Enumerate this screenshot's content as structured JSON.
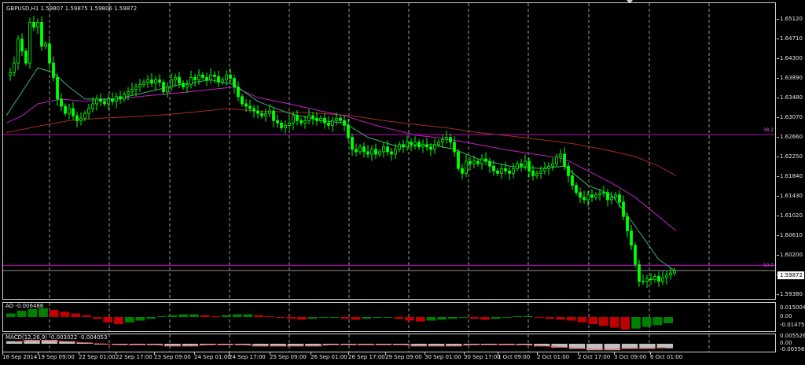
{
  "window": {
    "title": "GBPUSD,H1",
    "quote": "1.59807 1.59875 1.59806 1.59872"
  },
  "colors": {
    "background": "#000000",
    "candles": "#00ff00",
    "grid": "#c0c0c0",
    "ma_fast": "#3cb371",
    "ma_mid": "#c020c0",
    "ma_slow": "#a03020",
    "fib_line": "#c000c0",
    "ao_up": "#008000",
    "ao_down": "#c00000",
    "macd_hist": "#c0c0c0",
    "macd_signal": "#ff2020"
  },
  "price_scale": {
    "labels": [
      "1.65120",
      "1.64710",
      "1.64300",
      "1.63890",
      "1.63480",
      "1.63070",
      "1.62660",
      "1.62250",
      "1.61840",
      "1.61430",
      "1.61020",
      "1.60610",
      "1.60200",
      "1.59790",
      "1.59380"
    ],
    "current_price": "1.59872"
  },
  "fib_levels": [
    {
      "label": "38.2",
      "price": 1.6271
    },
    {
      "label": "50.0",
      "price": 1.5998
    }
  ],
  "ao": {
    "title": "AO -0.006486",
    "scale": [
      "0.015004",
      "0.00",
      "-0.014757"
    ]
  },
  "macd": {
    "title": "MACD(12,26,9) -0.003022 -0.004053",
    "scale": [
      "0.005526",
      "0.00",
      "-0.005566"
    ]
  },
  "time_axis": [
    "18 Sep 2014",
    "19 Sep 09:00",
    "22 Sep 01:00",
    "22 Sep 17:00",
    "23 Sep 09:00",
    "24 Sep 01:00",
    "24 Sep 17:00",
    "25 Sep 09:00",
    "26 Sep 01:00",
    "26 Sep 17:00",
    "29 Sep 09:00",
    "30 Sep 01:00",
    "30 Sep 17:00",
    "1 Oct 09:00",
    "2 Oct 01:00",
    "2 Oct 17:00",
    "3 Oct 09:00",
    "6 Oct 01:00"
  ],
  "chart_data": {
    "type": "line",
    "title": "GBPUSD,H1",
    "ylim": [
      1.5928,
      1.6545
    ],
    "close_path": [
      [
        0,
        1.6395
      ],
      [
        5,
        1.64
      ],
      [
        10,
        1.642
      ],
      [
        15,
        1.647
      ],
      [
        20,
        1.6445
      ],
      [
        25,
        1.642
      ],
      [
        30,
        1.6505
      ],
      [
        35,
        1.6495
      ],
      [
        40,
        1.6505
      ],
      [
        45,
        1.6455
      ],
      [
        50,
        1.646
      ],
      [
        55,
        1.642
      ],
      [
        60,
        1.639
      ],
      [
        65,
        1.6345
      ],
      [
        70,
        1.633
      ],
      [
        75,
        1.6315
      ],
      [
        80,
        1.6325
      ],
      [
        85,
        1.631
      ],
      [
        90,
        1.63
      ],
      [
        95,
        1.6305
      ],
      [
        100,
        1.6315
      ],
      [
        105,
        1.6325
      ],
      [
        110,
        1.6335
      ],
      [
        115,
        1.6345
      ],
      [
        120,
        1.634
      ],
      [
        125,
        1.6335
      ],
      [
        130,
        1.6345
      ],
      [
        135,
        1.634
      ],
      [
        140,
        1.635
      ],
      [
        145,
        1.6345
      ],
      [
        150,
        1.6355
      ],
      [
        155,
        1.636
      ],
      [
        160,
        1.6365
      ],
      [
        165,
        1.637
      ],
      [
        170,
        1.6375
      ],
      [
        175,
        1.638
      ],
      [
        180,
        1.6385
      ],
      [
        185,
        1.6378
      ],
      [
        190,
        1.6385
      ],
      [
        195,
        1.638
      ],
      [
        200,
        1.636
      ],
      [
        205,
        1.637
      ],
      [
        210,
        1.6385
      ],
      [
        215,
        1.639
      ],
      [
        220,
        1.6378
      ],
      [
        225,
        1.637
      ],
      [
        230,
        1.6375
      ],
      [
        235,
        1.639
      ],
      [
        240,
        1.6385
      ],
      [
        245,
        1.6395
      ],
      [
        250,
        1.639
      ],
      [
        255,
        1.6385
      ],
      [
        260,
        1.6395
      ],
      [
        265,
        1.6392
      ],
      [
        270,
        1.638
      ],
      [
        275,
        1.6385
      ],
      [
        280,
        1.6395
      ],
      [
        285,
        1.6388
      ],
      [
        290,
        1.637
      ],
      [
        295,
        1.635
      ],
      [
        300,
        1.6335
      ],
      [
        305,
        1.633
      ],
      [
        310,
        1.6325
      ],
      [
        315,
        1.632
      ],
      [
        320,
        1.6315
      ],
      [
        325,
        1.631
      ],
      [
        330,
        1.6315
      ],
      [
        335,
        1.632
      ],
      [
        340,
        1.63
      ],
      [
        345,
        1.6295
      ],
      [
        350,
        1.6285
      ],
      [
        355,
        1.629
      ],
      [
        360,
        1.6295
      ],
      [
        365,
        1.631
      ],
      [
        370,
        1.63
      ],
      [
        375,
        1.6295
      ],
      [
        380,
        1.63
      ],
      [
        385,
        1.631
      ],
      [
        390,
        1.6305
      ],
      [
        395,
        1.63
      ],
      [
        400,
        1.6305
      ],
      [
        405,
        1.6295
      ],
      [
        410,
        1.629
      ],
      [
        415,
        1.63
      ],
      [
        420,
        1.6305
      ],
      [
        425,
        1.63
      ],
      [
        430,
        1.629
      ],
      [
        435,
        1.6265
      ],
      [
        440,
        1.624
      ],
      [
        445,
        1.6235
      ],
      [
        450,
        1.6245
      ],
      [
        455,
        1.6235
      ],
      [
        460,
        1.623
      ],
      [
        465,
        1.624
      ],
      [
        470,
        1.623
      ],
      [
        475,
        1.6235
      ],
      [
        480,
        1.6245
      ],
      [
        485,
        1.6235
      ],
      [
        490,
        1.623
      ],
      [
        495,
        1.624
      ],
      [
        500,
        1.625
      ],
      [
        505,
        1.6245
      ],
      [
        510,
        1.6255
      ],
      [
        515,
        1.625
      ],
      [
        520,
        1.6255
      ],
      [
        525,
        1.6245
      ],
      [
        530,
        1.625
      ],
      [
        535,
        1.6245
      ],
      [
        540,
        1.624
      ],
      [
        545,
        1.625
      ],
      [
        550,
        1.6255
      ],
      [
        555,
        1.626
      ],
      [
        560,
        1.6265
      ],
      [
        565,
        1.6255
      ],
      [
        570,
        1.6235
      ],
      [
        575,
        1.62
      ],
      [
        580,
        1.619
      ],
      [
        585,
        1.6215
      ],
      [
        590,
        1.621
      ],
      [
        595,
        1.6215
      ],
      [
        600,
        1.621
      ],
      [
        605,
        1.622
      ],
      [
        610,
        1.6215
      ],
      [
        615,
        1.6205
      ],
      [
        620,
        1.6195
      ],
      [
        625,
        1.619
      ],
      [
        630,
        1.62
      ],
      [
        635,
        1.6195
      ],
      [
        640,
        1.619
      ],
      [
        645,
        1.62
      ],
      [
        650,
        1.621
      ],
      [
        655,
        1.6205
      ],
      [
        660,
        1.6215
      ],
      [
        665,
        1.6195
      ],
      [
        670,
        1.6185
      ],
      [
        675,
        1.619
      ],
      [
        680,
        1.6195
      ],
      [
        685,
        1.62
      ],
      [
        690,
        1.6205
      ],
      [
        695,
        1.621
      ],
      [
        700,
        1.6225
      ],
      [
        705,
        1.623
      ],
      [
        710,
        1.6205
      ],
      [
        715,
        1.6185
      ],
      [
        720,
        1.6165
      ],
      [
        725,
        1.615
      ],
      [
        730,
        1.614
      ],
      [
        735,
        1.6135
      ],
      [
        740,
        1.6145
      ],
      [
        745,
        1.614
      ],
      [
        750,
        1.6145
      ],
      [
        755,
        1.6148
      ],
      [
        760,
        1.615
      ],
      [
        765,
        1.6135
      ],
      [
        770,
        1.614
      ],
      [
        775,
        1.6145
      ],
      [
        780,
        1.613
      ],
      [
        785,
        1.61
      ],
      [
        790,
        1.607
      ],
      [
        795,
        1.604
      ],
      [
        800,
        1.6
      ],
      [
        805,
        1.5965
      ],
      [
        810,
        1.5965
      ],
      [
        815,
        1.597
      ],
      [
        820,
        1.5968
      ],
      [
        825,
        1.5975
      ],
      [
        830,
        1.5965
      ],
      [
        835,
        1.5972
      ],
      [
        840,
        1.5978
      ],
      [
        845,
        1.5982
      ],
      [
        850,
        1.5987
      ]
    ],
    "ma_fast_path": [
      [
        0,
        1.631
      ],
      [
        20,
        1.636
      ],
      [
        40,
        1.641
      ],
      [
        60,
        1.64
      ],
      [
        80,
        1.637
      ],
      [
        100,
        1.6345
      ],
      [
        140,
        1.6345
      ],
      [
        180,
        1.636
      ],
      [
        220,
        1.6375
      ],
      [
        260,
        1.6385
      ],
      [
        290,
        1.6375
      ],
      [
        320,
        1.634
      ],
      [
        360,
        1.6315
      ],
      [
        400,
        1.63
      ],
      [
        430,
        1.6295
      ],
      [
        460,
        1.6265
      ],
      [
        500,
        1.6245
      ],
      [
        540,
        1.625
      ],
      [
        570,
        1.624
      ],
      [
        600,
        1.622
      ],
      [
        640,
        1.6205
      ],
      [
        680,
        1.62
      ],
      [
        710,
        1.6205
      ],
      [
        740,
        1.6165
      ],
      [
        770,
        1.6145
      ],
      [
        800,
        1.608
      ],
      [
        830,
        1.601
      ],
      [
        852,
        1.5985
      ]
    ],
    "ma_mid_path": [
      [
        0,
        1.6295
      ],
      [
        20,
        1.631
      ],
      [
        40,
        1.6335
      ],
      [
        70,
        1.6345
      ],
      [
        100,
        1.634
      ],
      [
        140,
        1.6345
      ],
      [
        180,
        1.6352
      ],
      [
        220,
        1.6358
      ],
      [
        260,
        1.6365
      ],
      [
        290,
        1.637
      ],
      [
        320,
        1.6348
      ],
      [
        360,
        1.6335
      ],
      [
        400,
        1.632
      ],
      [
        430,
        1.631
      ],
      [
        470,
        1.629
      ],
      [
        520,
        1.627
      ],
      [
        560,
        1.6262
      ],
      [
        600,
        1.625
      ],
      [
        640,
        1.6238
      ],
      [
        680,
        1.6228
      ],
      [
        710,
        1.622
      ],
      [
        740,
        1.6195
      ],
      [
        770,
        1.617
      ],
      [
        800,
        1.614
      ],
      [
        830,
        1.61
      ],
      [
        852,
        1.607
      ]
    ],
    "ma_slow_path": [
      [
        0,
        1.6275
      ],
      [
        40,
        1.6288
      ],
      [
        80,
        1.63
      ],
      [
        120,
        1.6305
      ],
      [
        160,
        1.6308
      ],
      [
        200,
        1.6312
      ],
      [
        240,
        1.6318
      ],
      [
        280,
        1.6325
      ],
      [
        320,
        1.632
      ],
      [
        360,
        1.6318
      ],
      [
        400,
        1.6315
      ],
      [
        440,
        1.631
      ],
      [
        480,
        1.63
      ],
      [
        520,
        1.6292
      ],
      [
        560,
        1.6285
      ],
      [
        600,
        1.6275
      ],
      [
        640,
        1.6268
      ],
      [
        680,
        1.626
      ],
      [
        720,
        1.6252
      ],
      [
        760,
        1.624
      ],
      [
        800,
        1.6225
      ],
      [
        830,
        1.6205
      ],
      [
        852,
        1.6185
      ]
    ],
    "ao_values": [
      0.004,
      0.007,
      0.009,
      0.01,
      0.008,
      0.006,
      0.004,
      0.002,
      -0.002,
      -0.006,
      -0.008,
      -0.006,
      -0.004,
      -0.002,
      0.001,
      0.002,
      0.003,
      0.003,
      0.002,
      0.001,
      0.002,
      0.003,
      0.003,
      0.002,
      0.001,
      -0.001,
      -0.002,
      -0.003,
      -0.002,
      -0.001,
      -0.001,
      -0.002,
      -0.003,
      -0.002,
      -0.001,
      0.0,
      -0.002,
      -0.004,
      -0.005,
      -0.004,
      -0.003,
      -0.002,
      -0.001,
      -0.002,
      -0.003,
      -0.002,
      -0.001,
      0.001,
      0.001,
      -0.001,
      -0.002,
      -0.003,
      -0.004,
      -0.006,
      -0.008,
      -0.01,
      -0.012,
      -0.014,
      -0.013,
      -0.011,
      -0.009,
      -0.007
    ],
    "macd_values": [
      0.002,
      0.003,
      0.003,
      0.002,
      0.001,
      0.0,
      -0.001,
      -0.001,
      -0.001,
      -0.002,
      -0.002,
      -0.001,
      -0.001,
      -0.001,
      -0.002,
      -0.002,
      -0.002,
      -0.002,
      -0.001,
      -0.001,
      -0.001,
      -0.001,
      -0.001,
      -0.002,
      -0.002,
      -0.002,
      -0.001,
      -0.001,
      -0.001,
      -0.001,
      -0.002,
      -0.003,
      -0.004,
      -0.005,
      -0.005,
      -0.004,
      -0.004,
      -0.0035
    ]
  }
}
